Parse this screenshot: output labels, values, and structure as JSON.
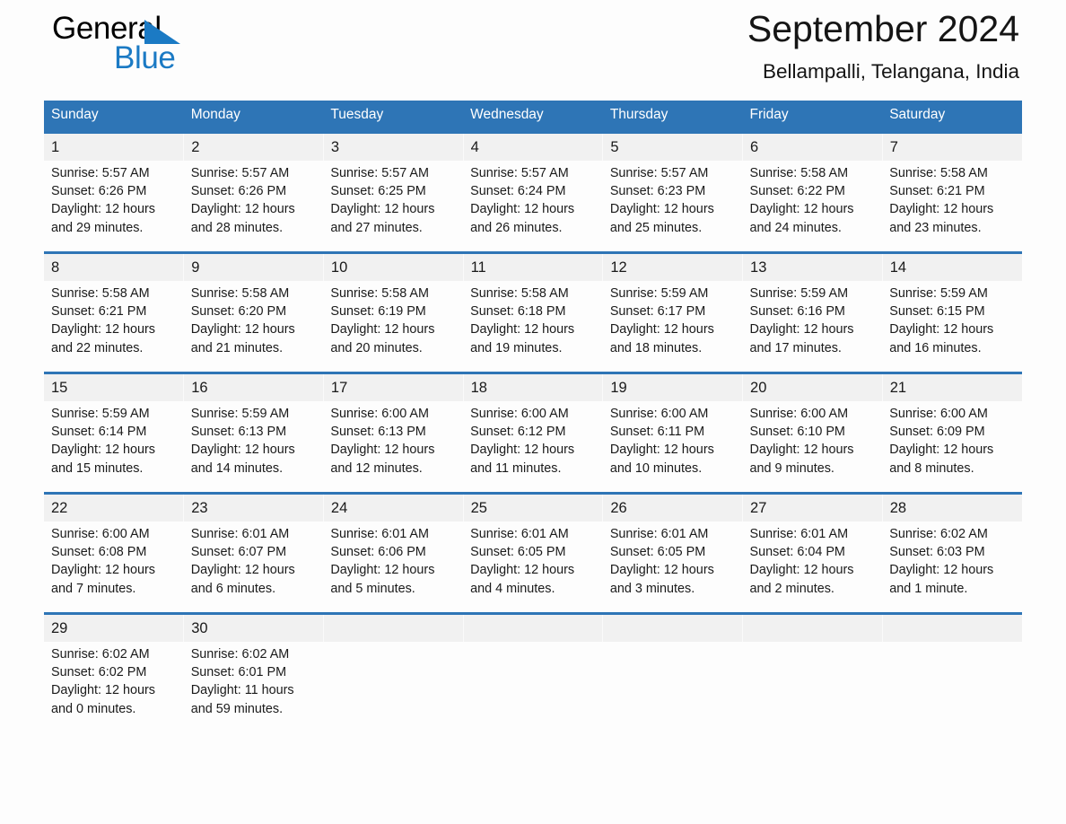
{
  "brand": {
    "logo_text_top": "General",
    "logo_text_bottom": "Blue",
    "logo_triangle": "blue-triangle-icon",
    "accent_color": "#2e75b6",
    "logo_blue": "#1b7ac4"
  },
  "header": {
    "title": "September 2024",
    "subtitle": "Bellampalli, Telangana, India"
  },
  "calendar": {
    "weekdays": [
      "Sunday",
      "Monday",
      "Tuesday",
      "Wednesday",
      "Thursday",
      "Friday",
      "Saturday"
    ],
    "weeks": [
      [
        {
          "date": "1",
          "sunrise": "Sunrise: 5:57 AM",
          "sunset": "Sunset: 6:26 PM",
          "daylight1": "Daylight: 12 hours",
          "daylight2": "and 29 minutes."
        },
        {
          "date": "2",
          "sunrise": "Sunrise: 5:57 AM",
          "sunset": "Sunset: 6:26 PM",
          "daylight1": "Daylight: 12 hours",
          "daylight2": "and 28 minutes."
        },
        {
          "date": "3",
          "sunrise": "Sunrise: 5:57 AM",
          "sunset": "Sunset: 6:25 PM",
          "daylight1": "Daylight: 12 hours",
          "daylight2": "and 27 minutes."
        },
        {
          "date": "4",
          "sunrise": "Sunrise: 5:57 AM",
          "sunset": "Sunset: 6:24 PM",
          "daylight1": "Daylight: 12 hours",
          "daylight2": "and 26 minutes."
        },
        {
          "date": "5",
          "sunrise": "Sunrise: 5:57 AM",
          "sunset": "Sunset: 6:23 PM",
          "daylight1": "Daylight: 12 hours",
          "daylight2": "and 25 minutes."
        },
        {
          "date": "6",
          "sunrise": "Sunrise: 5:58 AM",
          "sunset": "Sunset: 6:22 PM",
          "daylight1": "Daylight: 12 hours",
          "daylight2": "and 24 minutes."
        },
        {
          "date": "7",
          "sunrise": "Sunrise: 5:58 AM",
          "sunset": "Sunset: 6:21 PM",
          "daylight1": "Daylight: 12 hours",
          "daylight2": "and 23 minutes."
        }
      ],
      [
        {
          "date": "8",
          "sunrise": "Sunrise: 5:58 AM",
          "sunset": "Sunset: 6:21 PM",
          "daylight1": "Daylight: 12 hours",
          "daylight2": "and 22 minutes."
        },
        {
          "date": "9",
          "sunrise": "Sunrise: 5:58 AM",
          "sunset": "Sunset: 6:20 PM",
          "daylight1": "Daylight: 12 hours",
          "daylight2": "and 21 minutes."
        },
        {
          "date": "10",
          "sunrise": "Sunrise: 5:58 AM",
          "sunset": "Sunset: 6:19 PM",
          "daylight1": "Daylight: 12 hours",
          "daylight2": "and 20 minutes."
        },
        {
          "date": "11",
          "sunrise": "Sunrise: 5:58 AM",
          "sunset": "Sunset: 6:18 PM",
          "daylight1": "Daylight: 12 hours",
          "daylight2": "and 19 minutes."
        },
        {
          "date": "12",
          "sunrise": "Sunrise: 5:59 AM",
          "sunset": "Sunset: 6:17 PM",
          "daylight1": "Daylight: 12 hours",
          "daylight2": "and 18 minutes."
        },
        {
          "date": "13",
          "sunrise": "Sunrise: 5:59 AM",
          "sunset": "Sunset: 6:16 PM",
          "daylight1": "Daylight: 12 hours",
          "daylight2": "and 17 minutes."
        },
        {
          "date": "14",
          "sunrise": "Sunrise: 5:59 AM",
          "sunset": "Sunset: 6:15 PM",
          "daylight1": "Daylight: 12 hours",
          "daylight2": "and 16 minutes."
        }
      ],
      [
        {
          "date": "15",
          "sunrise": "Sunrise: 5:59 AM",
          "sunset": "Sunset: 6:14 PM",
          "daylight1": "Daylight: 12 hours",
          "daylight2": "and 15 minutes."
        },
        {
          "date": "16",
          "sunrise": "Sunrise: 5:59 AM",
          "sunset": "Sunset: 6:13 PM",
          "daylight1": "Daylight: 12 hours",
          "daylight2": "and 14 minutes."
        },
        {
          "date": "17",
          "sunrise": "Sunrise: 6:00 AM",
          "sunset": "Sunset: 6:13 PM",
          "daylight1": "Daylight: 12 hours",
          "daylight2": "and 12 minutes."
        },
        {
          "date": "18",
          "sunrise": "Sunrise: 6:00 AM",
          "sunset": "Sunset: 6:12 PM",
          "daylight1": "Daylight: 12 hours",
          "daylight2": "and 11 minutes."
        },
        {
          "date": "19",
          "sunrise": "Sunrise: 6:00 AM",
          "sunset": "Sunset: 6:11 PM",
          "daylight1": "Daylight: 12 hours",
          "daylight2": "and 10 minutes."
        },
        {
          "date": "20",
          "sunrise": "Sunrise: 6:00 AM",
          "sunset": "Sunset: 6:10 PM",
          "daylight1": "Daylight: 12 hours",
          "daylight2": "and 9 minutes."
        },
        {
          "date": "21",
          "sunrise": "Sunrise: 6:00 AM",
          "sunset": "Sunset: 6:09 PM",
          "daylight1": "Daylight: 12 hours",
          "daylight2": "and 8 minutes."
        }
      ],
      [
        {
          "date": "22",
          "sunrise": "Sunrise: 6:00 AM",
          "sunset": "Sunset: 6:08 PM",
          "daylight1": "Daylight: 12 hours",
          "daylight2": "and 7 minutes."
        },
        {
          "date": "23",
          "sunrise": "Sunrise: 6:01 AM",
          "sunset": "Sunset: 6:07 PM",
          "daylight1": "Daylight: 12 hours",
          "daylight2": "and 6 minutes."
        },
        {
          "date": "24",
          "sunrise": "Sunrise: 6:01 AM",
          "sunset": "Sunset: 6:06 PM",
          "daylight1": "Daylight: 12 hours",
          "daylight2": "and 5 minutes."
        },
        {
          "date": "25",
          "sunrise": "Sunrise: 6:01 AM",
          "sunset": "Sunset: 6:05 PM",
          "daylight1": "Daylight: 12 hours",
          "daylight2": "and 4 minutes."
        },
        {
          "date": "26",
          "sunrise": "Sunrise: 6:01 AM",
          "sunset": "Sunset: 6:05 PM",
          "daylight1": "Daylight: 12 hours",
          "daylight2": "and 3 minutes."
        },
        {
          "date": "27",
          "sunrise": "Sunrise: 6:01 AM",
          "sunset": "Sunset: 6:04 PM",
          "daylight1": "Daylight: 12 hours",
          "daylight2": "and 2 minutes."
        },
        {
          "date": "28",
          "sunrise": "Sunrise: 6:02 AM",
          "sunset": "Sunset: 6:03 PM",
          "daylight1": "Daylight: 12 hours",
          "daylight2": "and 1 minute."
        }
      ],
      [
        {
          "date": "29",
          "sunrise": "Sunrise: 6:02 AM",
          "sunset": "Sunset: 6:02 PM",
          "daylight1": "Daylight: 12 hours",
          "daylight2": "and 0 minutes."
        },
        {
          "date": "30",
          "sunrise": "Sunrise: 6:02 AM",
          "sunset": "Sunset: 6:01 PM",
          "daylight1": "Daylight: 11 hours",
          "daylight2": "and 59 minutes."
        },
        {
          "date": "",
          "sunrise": "",
          "sunset": "",
          "daylight1": "",
          "daylight2": ""
        },
        {
          "date": "",
          "sunrise": "",
          "sunset": "",
          "daylight1": "",
          "daylight2": ""
        },
        {
          "date": "",
          "sunrise": "",
          "sunset": "",
          "daylight1": "",
          "daylight2": ""
        },
        {
          "date": "",
          "sunrise": "",
          "sunset": "",
          "daylight1": "",
          "daylight2": ""
        },
        {
          "date": "",
          "sunrise": "",
          "sunset": "",
          "daylight1": "",
          "daylight2": ""
        }
      ]
    ]
  }
}
